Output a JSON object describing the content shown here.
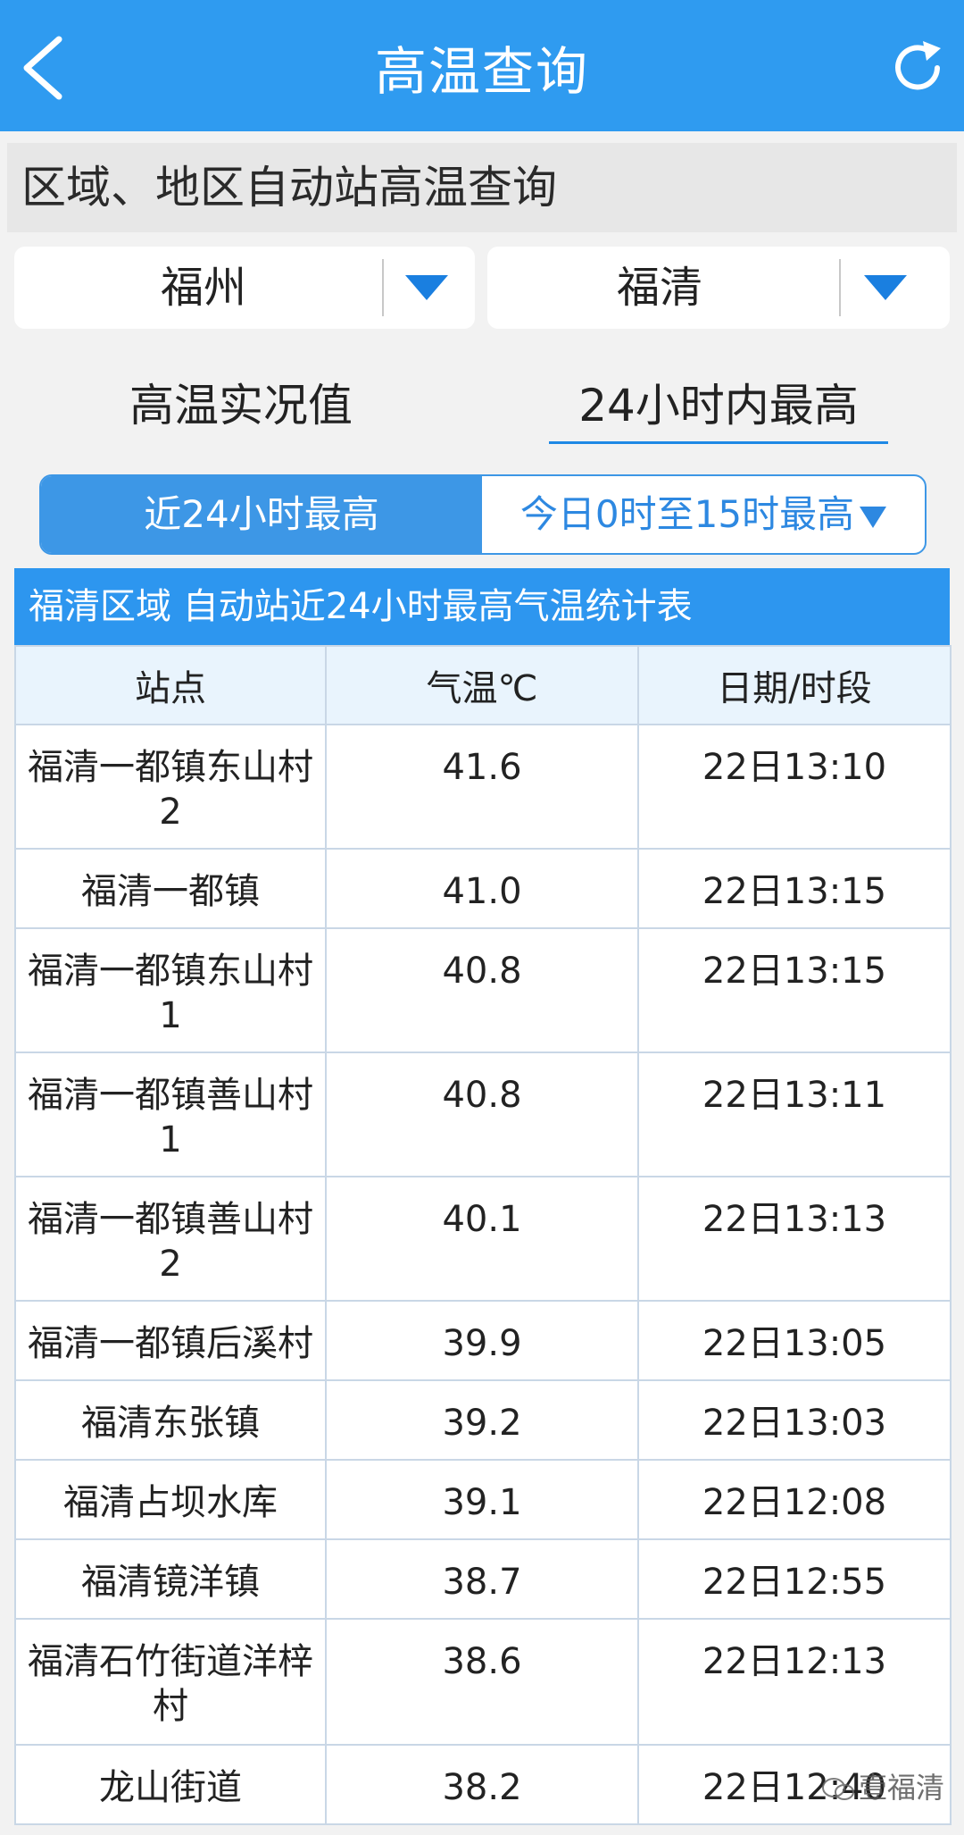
{
  "header": {
    "title": "高温查询"
  },
  "section": {
    "title": "区域、地区自动站高温查询"
  },
  "selects": {
    "city": "福州",
    "district": "福清"
  },
  "modes": {
    "live": "高温实况值",
    "max24": "24小时内最高"
  },
  "segment": {
    "left": "近24小时最高",
    "right": "今日0时至15时最高"
  },
  "table": {
    "title": "福清区域 自动站近24小时最高气温统计表",
    "columns": [
      "站点",
      "气温℃",
      "日期/时段"
    ],
    "rows": [
      {
        "station": "福清一都镇东山村2",
        "temp": "41.6",
        "time": "22日13:10"
      },
      {
        "station": "福清一都镇",
        "temp": "41.0",
        "time": "22日13:15"
      },
      {
        "station": "福清一都镇东山村1",
        "temp": "40.8",
        "time": "22日13:15"
      },
      {
        "station": "福清一都镇善山村1",
        "temp": "40.8",
        "time": "22日13:11"
      },
      {
        "station": "福清一都镇善山村2",
        "temp": "40.1",
        "time": "22日13:13"
      },
      {
        "station": "福清一都镇后溪村",
        "temp": "39.9",
        "time": "22日13:05"
      },
      {
        "station": "福清东张镇",
        "temp": "39.2",
        "time": "22日13:03"
      },
      {
        "station": "福清占坝水库",
        "temp": "39.1",
        "time": "22日12:08"
      },
      {
        "station": "福清镜洋镇",
        "temp": "38.7",
        "time": "22日12:55"
      },
      {
        "station": "福清石竹街道洋梓村",
        "temp": "38.6",
        "time": "22日12:13"
      },
      {
        "station": "龙山街道",
        "temp": "38.2",
        "time": "22日12:40"
      }
    ]
  },
  "watermark": "壹福清",
  "colors": {
    "header_bg": "#2f9bf0",
    "accent": "#3d97e6",
    "table_header_bg": "#e9f4fd"
  }
}
